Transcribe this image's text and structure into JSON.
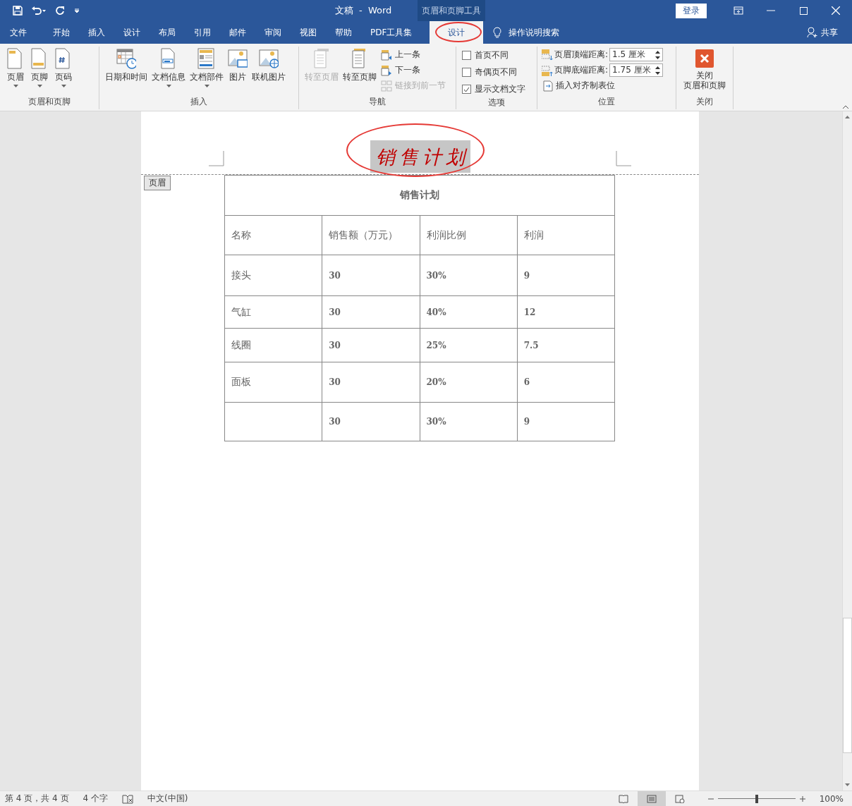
{
  "title_bar": {
    "title": "文稿  -  Word",
    "context_label": "页眉和页脚工具",
    "login": "登录"
  },
  "tabs": [
    {
      "label": "文件",
      "selected": false,
      "kind": "normal"
    },
    {
      "label": "开始",
      "selected": false,
      "kind": "normal"
    },
    {
      "label": "插入",
      "selected": false,
      "kind": "normal"
    },
    {
      "label": "设计",
      "selected": false,
      "kind": "normal"
    },
    {
      "label": "布局",
      "selected": false,
      "kind": "normal"
    },
    {
      "label": "引用",
      "selected": false,
      "kind": "normal"
    },
    {
      "label": "邮件",
      "selected": false,
      "kind": "normal"
    },
    {
      "label": "审阅",
      "selected": false,
      "kind": "normal"
    },
    {
      "label": "视图",
      "selected": false,
      "kind": "normal"
    },
    {
      "label": "帮助",
      "selected": false,
      "kind": "normal"
    },
    {
      "label": "PDF工具集",
      "selected": false,
      "kind": "normal"
    },
    {
      "label": "设计",
      "selected": true,
      "kind": "context"
    }
  ],
  "tell_me": "操作说明搜索",
  "share": "共享",
  "ribbon": [
    {
      "label": "页眉和页脚",
      "items": [
        {
          "kind": "large",
          "label": "页眉",
          "dropdown": true,
          "disabled": false
        },
        {
          "kind": "large",
          "label": "页脚",
          "dropdown": true,
          "disabled": false
        },
        {
          "kind": "large",
          "label": "页码",
          "dropdown": true,
          "disabled": false
        }
      ]
    },
    {
      "label": "插入",
      "items": [
        {
          "kind": "large",
          "label": "日期和时间",
          "dropdown": false,
          "disabled": false
        },
        {
          "kind": "large",
          "label": "文档信息",
          "dropdown": true,
          "disabled": false
        },
        {
          "kind": "large",
          "label": "文档部件",
          "dropdown": true,
          "disabled": false
        },
        {
          "kind": "large",
          "label": "图片",
          "dropdown": false,
          "disabled": false
        },
        {
          "kind": "large",
          "label": "联机图片",
          "dropdown": false,
          "disabled": false
        }
      ]
    },
    {
      "label": "导航",
      "items": [
        {
          "kind": "large",
          "label": "转至页眉",
          "dropdown": false,
          "disabled": true
        },
        {
          "kind": "large",
          "label": "转至页脚",
          "dropdown": false,
          "disabled": false
        },
        {
          "kind": "small",
          "label": "上一条",
          "disabled": false
        },
        {
          "kind": "small",
          "label": "下一条",
          "disabled": false
        },
        {
          "kind": "small",
          "label": "链接到前一节",
          "disabled": true
        }
      ]
    },
    {
      "label": "选项",
      "items": [
        {
          "kind": "checkbox",
          "label": "首页不同",
          "checked": false
        },
        {
          "kind": "checkbox",
          "label": "奇偶页不同",
          "checked": false
        },
        {
          "kind": "checkbox",
          "label": "显示文档文字",
          "checked": true
        }
      ]
    },
    {
      "label": "位置",
      "items": [
        {
          "kind": "spinner",
          "label": "页眉顶端距离:",
          "value": "1.5 厘米"
        },
        {
          "kind": "spinner",
          "label": "页脚底端距离:",
          "value": "1.75 厘米"
        },
        {
          "kind": "small",
          "label": "插入对齐制表位",
          "disabled": false
        }
      ]
    },
    {
      "label": "关闭",
      "items": [
        {
          "kind": "close",
          "label": [
            "关闭",
            "页眉和页脚"
          ]
        }
      ]
    }
  ],
  "document": {
    "header": {
      "text": "销售计划",
      "tag": "页眉"
    },
    "table": {
      "title": "销售计划",
      "columns": [
        "名称",
        "销售额（万元）",
        "利润比例",
        "利润"
      ],
      "rows": [
        [
          "接头",
          "30",
          "30%",
          "9"
        ],
        [
          "气缸",
          "30",
          "40%",
          "12"
        ],
        [
          "线圈",
          "30",
          "25%",
          "7.5"
        ],
        [
          "面板",
          "30",
          "20%",
          "6"
        ],
        [
          null,
          "30",
          "30%",
          "9"
        ]
      ]
    }
  },
  "status_bar": {
    "page_info": "第 4 页，共 4 页",
    "word_count": "4 个字",
    "language": "中文(中国)",
    "views": [
      {
        "selected": false
      },
      {
        "selected": true
      },
      {
        "selected": false
      }
    ],
    "zoom": {
      "level": 0.5,
      "reading": "100%"
    }
  }
}
